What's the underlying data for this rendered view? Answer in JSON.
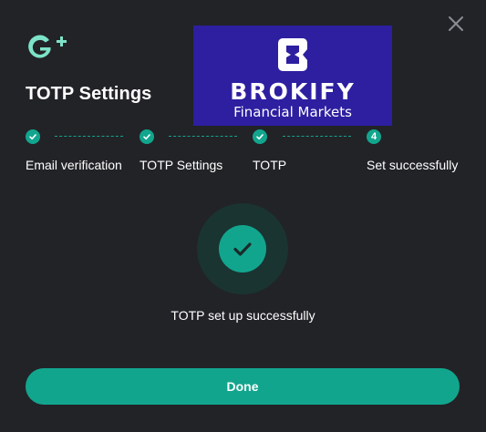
{
  "dialog": {
    "title": "TOTP Settings",
    "close_icon": "close-icon",
    "logo_icon": "g-plus-logo-icon",
    "brand_color": "#12a58e",
    "background_color": "#222327"
  },
  "banner": {
    "name": "BROKIFY",
    "subtitle": "Financial Markets",
    "background_color": "#2d1fa0"
  },
  "steps": [
    {
      "label": "Email verification",
      "status": "completed",
      "icon": "check-icon"
    },
    {
      "label": "TOTP Settings",
      "status": "completed",
      "icon": "check-icon"
    },
    {
      "label": "TOTP",
      "status": "completed",
      "icon": "check-icon"
    },
    {
      "label": "Set successfully",
      "status": "current",
      "number": "4"
    }
  ],
  "result": {
    "icon": "success-check-icon",
    "message": "TOTP set up successfully"
  },
  "actions": {
    "done_label": "Done"
  }
}
